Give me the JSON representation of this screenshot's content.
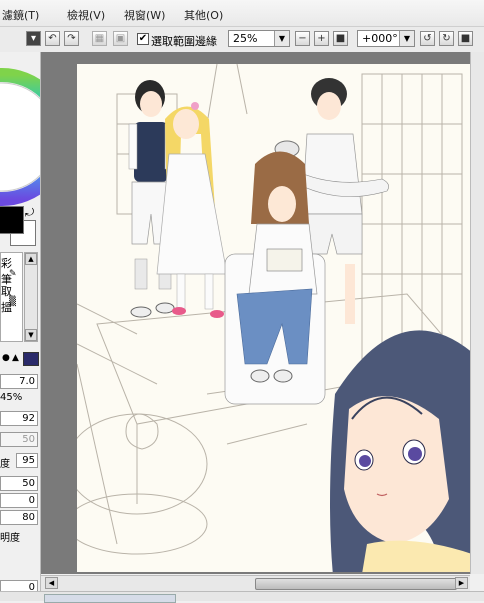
{
  "menu": {
    "items": [
      "濾鏡(T)",
      "檢視(V)",
      "視窗(W)",
      "其他(O)"
    ]
  },
  "toolbar": {
    "checkbox_checked": "✔",
    "select_edge_label": "選取範圍邊緣",
    "zoom_value": "25%",
    "rotation_value": "+000°",
    "plus": "+",
    "minus": "−"
  },
  "left_panel": {
    "tool_labels": [
      "彩筆",
      "取搵"
    ],
    "fields": [
      {
        "label": "",
        "value": "7.0",
        "gray": false
      },
      {
        "label": "45%",
        "value": "",
        "gray": false
      },
      {
        "label": "",
        "value": "92",
        "gray": false
      },
      {
        "label": "度",
        "value": "50",
        "gray": true
      },
      {
        "label": "度",
        "value": "95",
        "gray": false
      },
      {
        "label": "",
        "value": "50",
        "gray": false
      },
      {
        "label": "",
        "value": "0",
        "gray": false
      },
      {
        "label": "",
        "value": "80",
        "gray": false
      },
      {
        "label": "明度",
        "value": "",
        "gray": false
      },
      {
        "label": "",
        "value": "0",
        "gray": false
      }
    ]
  },
  "colors": {
    "foreground": "#000000",
    "background": "#ffffff",
    "paper": "#fdfbf3",
    "workspace": "#7a7a7a"
  },
  "icons": {
    "undo": "↶",
    "redo": "↷",
    "swap": "⤾",
    "arrow_down": "▼",
    "arrow_up": "▲",
    "arrow_left": "◀",
    "arrow_right": "▶"
  }
}
